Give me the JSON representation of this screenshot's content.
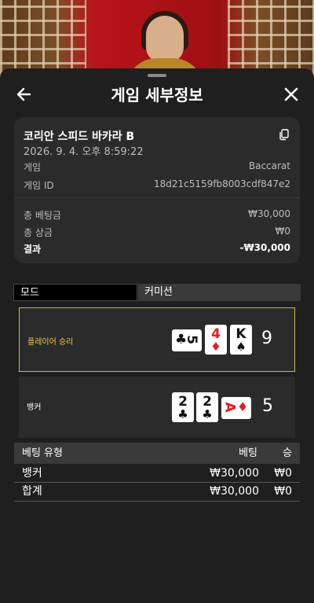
{
  "header": {
    "title": "게임 세부정보"
  },
  "game": {
    "name": "코리안 스피드 바카라 B",
    "datetime": "2026. 9. 4. 오후 8:59:22",
    "type_label": "게임",
    "type_value": "Baccarat",
    "id_label": "게임 ID",
    "id_value": "18d21c5159fb8003cdf847e2"
  },
  "summary": {
    "total_bet_label": "총 베팅금",
    "total_bet_value": "₩30,000",
    "total_win_label": "총 상금",
    "total_win_value": "₩0",
    "result_label": "결과",
    "result_value": "-₩30,000"
  },
  "mode": {
    "mode_label": "모드",
    "commission_label": "커미션"
  },
  "player": {
    "label": "플레이어 승리",
    "score": "9",
    "cards": [
      {
        "rank": "5",
        "suit": "♣",
        "color": "#111111",
        "orientation": "horizontal"
      },
      {
        "rank": "4",
        "suit": "♦",
        "color": "#e31b23",
        "orientation": "vertical"
      },
      {
        "rank": "K",
        "suit": "♠",
        "color": "#111111",
        "orientation": "vertical"
      }
    ]
  },
  "banker": {
    "label": "뱅커",
    "score": "5",
    "cards": [
      {
        "rank": "2",
        "suit": "♣",
        "color": "#111111",
        "orientation": "vertical"
      },
      {
        "rank": "2",
        "suit": "♣",
        "color": "#111111",
        "orientation": "vertical"
      },
      {
        "rank": "A",
        "suit": "♦",
        "color": "#e31b23",
        "orientation": "horizontal"
      }
    ]
  },
  "bets_table": {
    "headers": {
      "type": "베팅 유형",
      "bet": "베팅",
      "win": "승"
    },
    "rows": [
      {
        "type": "뱅커",
        "bet": "₩30,000",
        "win": "₩0"
      }
    ],
    "total": {
      "type": "합계",
      "bet": "₩30,000",
      "win": "₩0"
    }
  },
  "colors": {
    "accent_gold": "#d4b84a",
    "card_red": "#e31b23",
    "panel": "#2b2b2b"
  },
  "icons": {
    "back": "arrow-left-icon",
    "close": "close-icon",
    "copy": "copy-icon"
  }
}
